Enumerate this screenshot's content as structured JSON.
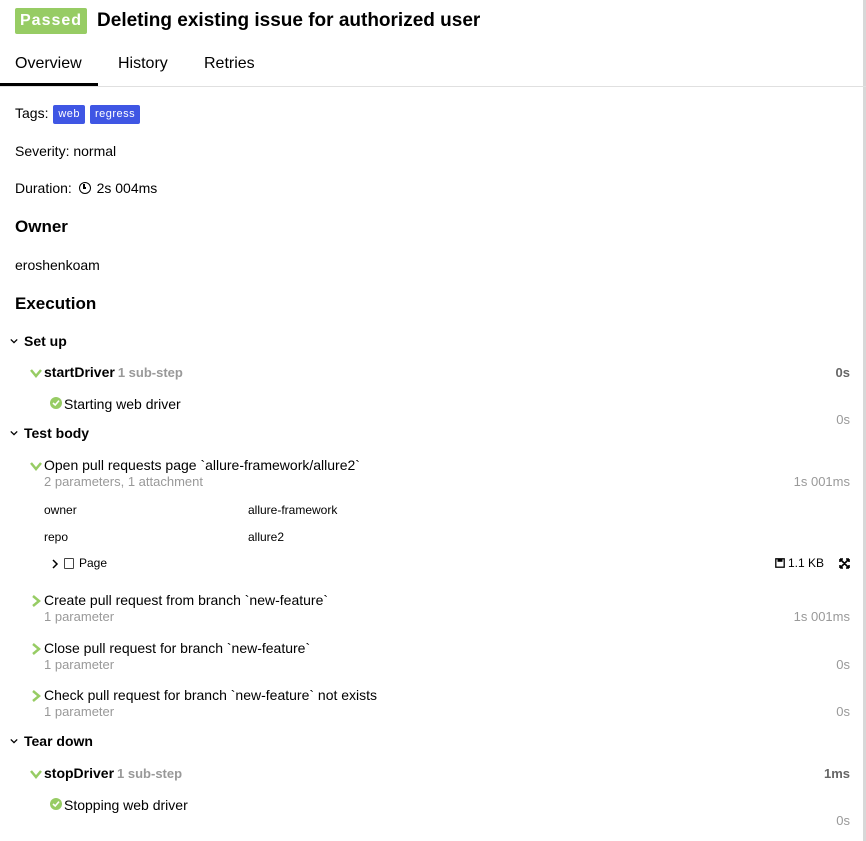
{
  "header": {
    "status": "Passed",
    "title": "Deleting existing issue for authorized user"
  },
  "tabs": [
    "Overview",
    "History",
    "Retries"
  ],
  "info": {
    "tags_label": "Tags:",
    "tags": [
      "web",
      "regress"
    ],
    "severity": "Severity: normal",
    "duration_label": "Duration:",
    "duration_value": "2s 004ms"
  },
  "owner": {
    "title": "Owner",
    "value": "eroshenkoam"
  },
  "execution": {
    "title": "Execution",
    "setup": {
      "label": "Set up",
      "step": {
        "name": "startDriver",
        "substeps": "1 sub-step",
        "time": "0s"
      },
      "leaf": {
        "name": "Starting web driver",
        "time": "0s"
      }
    },
    "body": {
      "label": "Test body",
      "steps": [
        {
          "name": "Open pull requests page `allure-framework/allure2`",
          "sub": "2 parameters, 1 attachment",
          "time": "1s 001ms"
        },
        {
          "name": "Create pull request from branch `new-feature`",
          "sub": "1 parameter",
          "time": "1s 001ms"
        },
        {
          "name": "Close pull request for branch `new-feature`",
          "sub": "1 parameter",
          "time": "0s"
        },
        {
          "name": "Check pull request for branch `new-feature` not exists",
          "sub": "1 parameter",
          "time": "0s"
        }
      ],
      "params": [
        {
          "name": "owner",
          "value": "allure-framework"
        },
        {
          "name": "repo",
          "value": "allure2"
        }
      ],
      "attachment": {
        "name": "Page",
        "size": "1.1 KB"
      }
    },
    "teardown": {
      "label": "Tear down",
      "step": {
        "name": "stopDriver",
        "substeps": "1 sub-step",
        "time": "1ms"
      },
      "leaf": {
        "name": "Stopping web driver",
        "time": "0s"
      }
    }
  },
  "colors": {
    "passed": "#97cc64",
    "tag": "#3f56e4",
    "muted": "#999999"
  }
}
